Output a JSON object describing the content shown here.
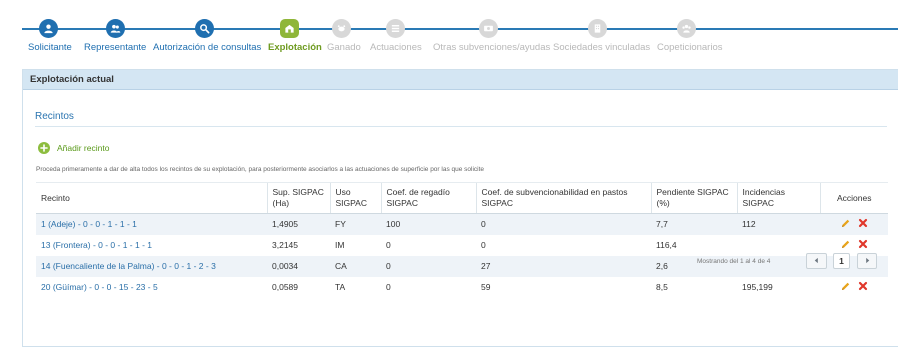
{
  "colors": {
    "primary": "#1f6fb0",
    "active": "#8fb639",
    "pending": "#d8d8d8",
    "delete": "#e0372b",
    "edit": "#e8a41a"
  },
  "wizard": {
    "steps": [
      {
        "label": "Solicitante",
        "status": "done",
        "icon": "user-icon"
      },
      {
        "label": "Representante",
        "status": "done",
        "icon": "users-icon"
      },
      {
        "label": "Autorización de consultas",
        "status": "done",
        "icon": "search-icon"
      },
      {
        "label": "Explotación",
        "status": "active",
        "icon": "farm-icon"
      },
      {
        "label": "Ganado",
        "status": "pending",
        "icon": "cow-icon"
      },
      {
        "label": "Actuaciones",
        "status": "pending",
        "icon": "tasks-icon"
      },
      {
        "label": "Otras subvenciones/ayudas",
        "status": "pending",
        "icon": "money-icon"
      },
      {
        "label": "Sociedades vinculadas",
        "status": "pending",
        "icon": "building-icon"
      },
      {
        "label": "Copeticionarios",
        "status": "pending",
        "icon": "group-icon"
      }
    ]
  },
  "panel": {
    "title": "Explotación actual",
    "section_title": "Recintos",
    "add_button": "Añadir recinto",
    "help_text": "Proceda primeramente a dar de alta todos los recintos de su explotación, para posteriormente asociarlos a las actuaciones de superficie por las que solicite"
  },
  "table": {
    "headers": [
      "Recinto",
      "Sup. SIGPAC (Ha)",
      "Uso SIGPAC",
      "Coef. de regadío SIGPAC",
      "Coef. de subvencionabilidad en pastos SIGPAC",
      "Pendiente SIGPAC (%)",
      "Incidencias SIGPAC",
      "Acciones"
    ],
    "rows": [
      [
        "1 (Adeje) - 0 - 0 - 1 - 1 - 1",
        "1,4905",
        "FY",
        "100",
        "0",
        "7,7",
        "112"
      ],
      [
        "13 (Frontera) - 0 - 0 - 1 - 1 - 1",
        "3,2145",
        "IM",
        "0",
        "0",
        "116,4",
        ""
      ],
      [
        "14 (Fuencaliente de la Palma) - 0 - 0 - 1 - 2 - 3",
        "0,0034",
        "CA",
        "0",
        "27",
        "2,6",
        ""
      ],
      [
        "20 (Güímar) - 0 - 0 - 15 - 23 - 5",
        "0,0589",
        "TA",
        "0",
        "59",
        "8,5",
        "195,199"
      ]
    ],
    "row_actions": [
      "edit-icon",
      "delete-icon"
    ]
  },
  "footer": {
    "info": "Mostrando del 1 al 4 de 4",
    "current_page": "1",
    "prev_icon": "chevron-left-icon",
    "next_icon": "chevron-right-icon"
  }
}
